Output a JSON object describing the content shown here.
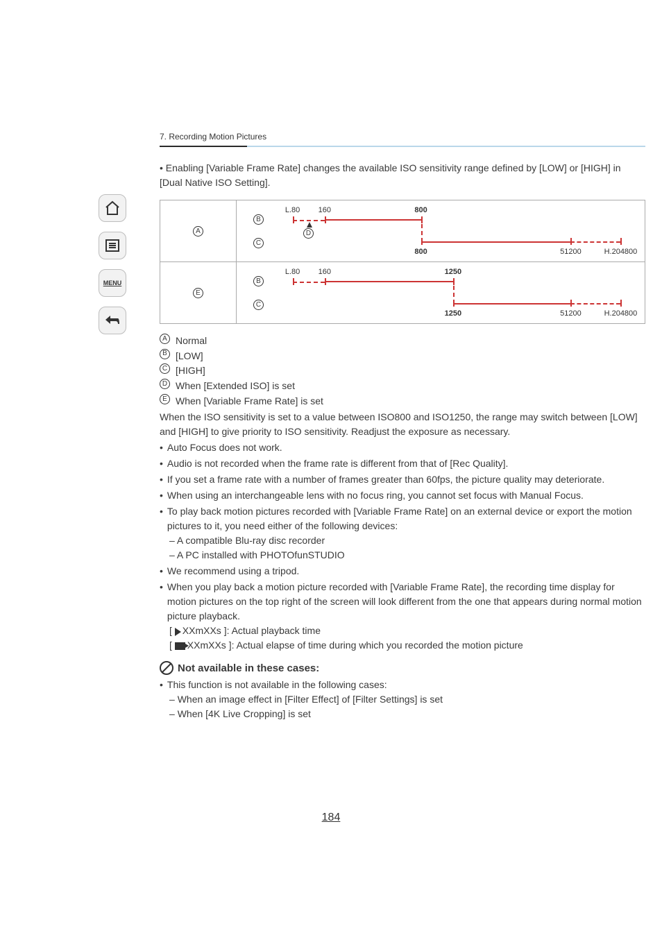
{
  "section_header": "7. Recording Motion Pictures",
  "intro": "• Enabling [Variable Frame Rate] changes the available ISO sensitivity range defined by [LOW] or [HIGH] in [Dual Native ISO Setting].",
  "diagram": {
    "row_a_label": "A",
    "row_e_label": "E",
    "b_label": "B",
    "c_label": "C",
    "d_label": "D",
    "ticks_b": {
      "l80": "L.80",
      "v160": "160",
      "v800_top": "800",
      "v800_bottom": "800"
    },
    "ticks_c": {
      "v51200": "51200",
      "h204800": "H.204800"
    },
    "ticks_b2": {
      "l80": "L.80",
      "v160": "160",
      "v1250_top": "1250",
      "v1250_bottom": "1250"
    },
    "ticks_c2": {
      "v51200": "51200",
      "h204800": "H.204800"
    }
  },
  "legend": {
    "A": "Normal",
    "B": "[LOW]",
    "C": "[HIGH]",
    "D": "When [Extended ISO] is set",
    "E": "When [Variable Frame Rate] is set",
    "note": "When the ISO sensitivity is set to a value between ISO800 and ISO1250, the range may switch between [LOW] and [HIGH] to give priority to ISO sensitivity. Readjust the exposure as necessary."
  },
  "bullets": [
    "Auto Focus does not work.",
    "Audio is not recorded when the frame rate is different from that of [Rec Quality].",
    "If you set a frame rate with a number of frames greater than 60fps, the picture quality may deteriorate.",
    "When using an interchangeable lens with no focus ring, you cannot set focus with Manual Focus.",
    "To play back motion pictures recorded with [Variable Frame Rate] on an external device or export the motion pictures to it, you need either of the following devices:"
  ],
  "sub_bullets_5": [
    "A compatible Blu-ray disc recorder",
    "A PC installed with PHOTOfunSTUDIO"
  ],
  "bullets2": [
    "We recommend using a tripod.",
    "When you play back a motion picture recorded with [Variable Frame Rate], the recording time display for motion pictures on the top right of the screen will look different from the one that appears during normal motion picture playback."
  ],
  "time_lines": {
    "play_label": "XXmXXs",
    "play_desc": "]: Actual playback time",
    "rec_label": "XXmXXs",
    "rec_desc": "]: Actual elapse of time during which you recorded the motion picture"
  },
  "na_title": "Not available in these cases:",
  "na_lead": "This function is not available in the following cases:",
  "na_items": [
    "When an image effect in [Filter Effect] of [Filter Settings] is set",
    "When [4K Live Cropping] is set"
  ],
  "page_number": "184",
  "chart_data": [
    {
      "type": "range",
      "title": "Normal — ISO range diagram",
      "series": [
        {
          "name": "LOW (B)",
          "extended_low": 80,
          "min": 160,
          "max": 800
        },
        {
          "name": "HIGH (C)",
          "min": 800,
          "max": 51200,
          "extended_high": 204800
        }
      ],
      "annotations": [
        "D marks extended-ISO dashed segment L.80–160"
      ]
    },
    {
      "type": "range",
      "title": "Variable Frame Rate (E) — ISO range diagram",
      "series": [
        {
          "name": "LOW (B)",
          "extended_low": 80,
          "min": 160,
          "max": 1250
        },
        {
          "name": "HIGH (C)",
          "min": 1250,
          "max": 51200,
          "extended_high": 204800
        }
      ]
    }
  ]
}
